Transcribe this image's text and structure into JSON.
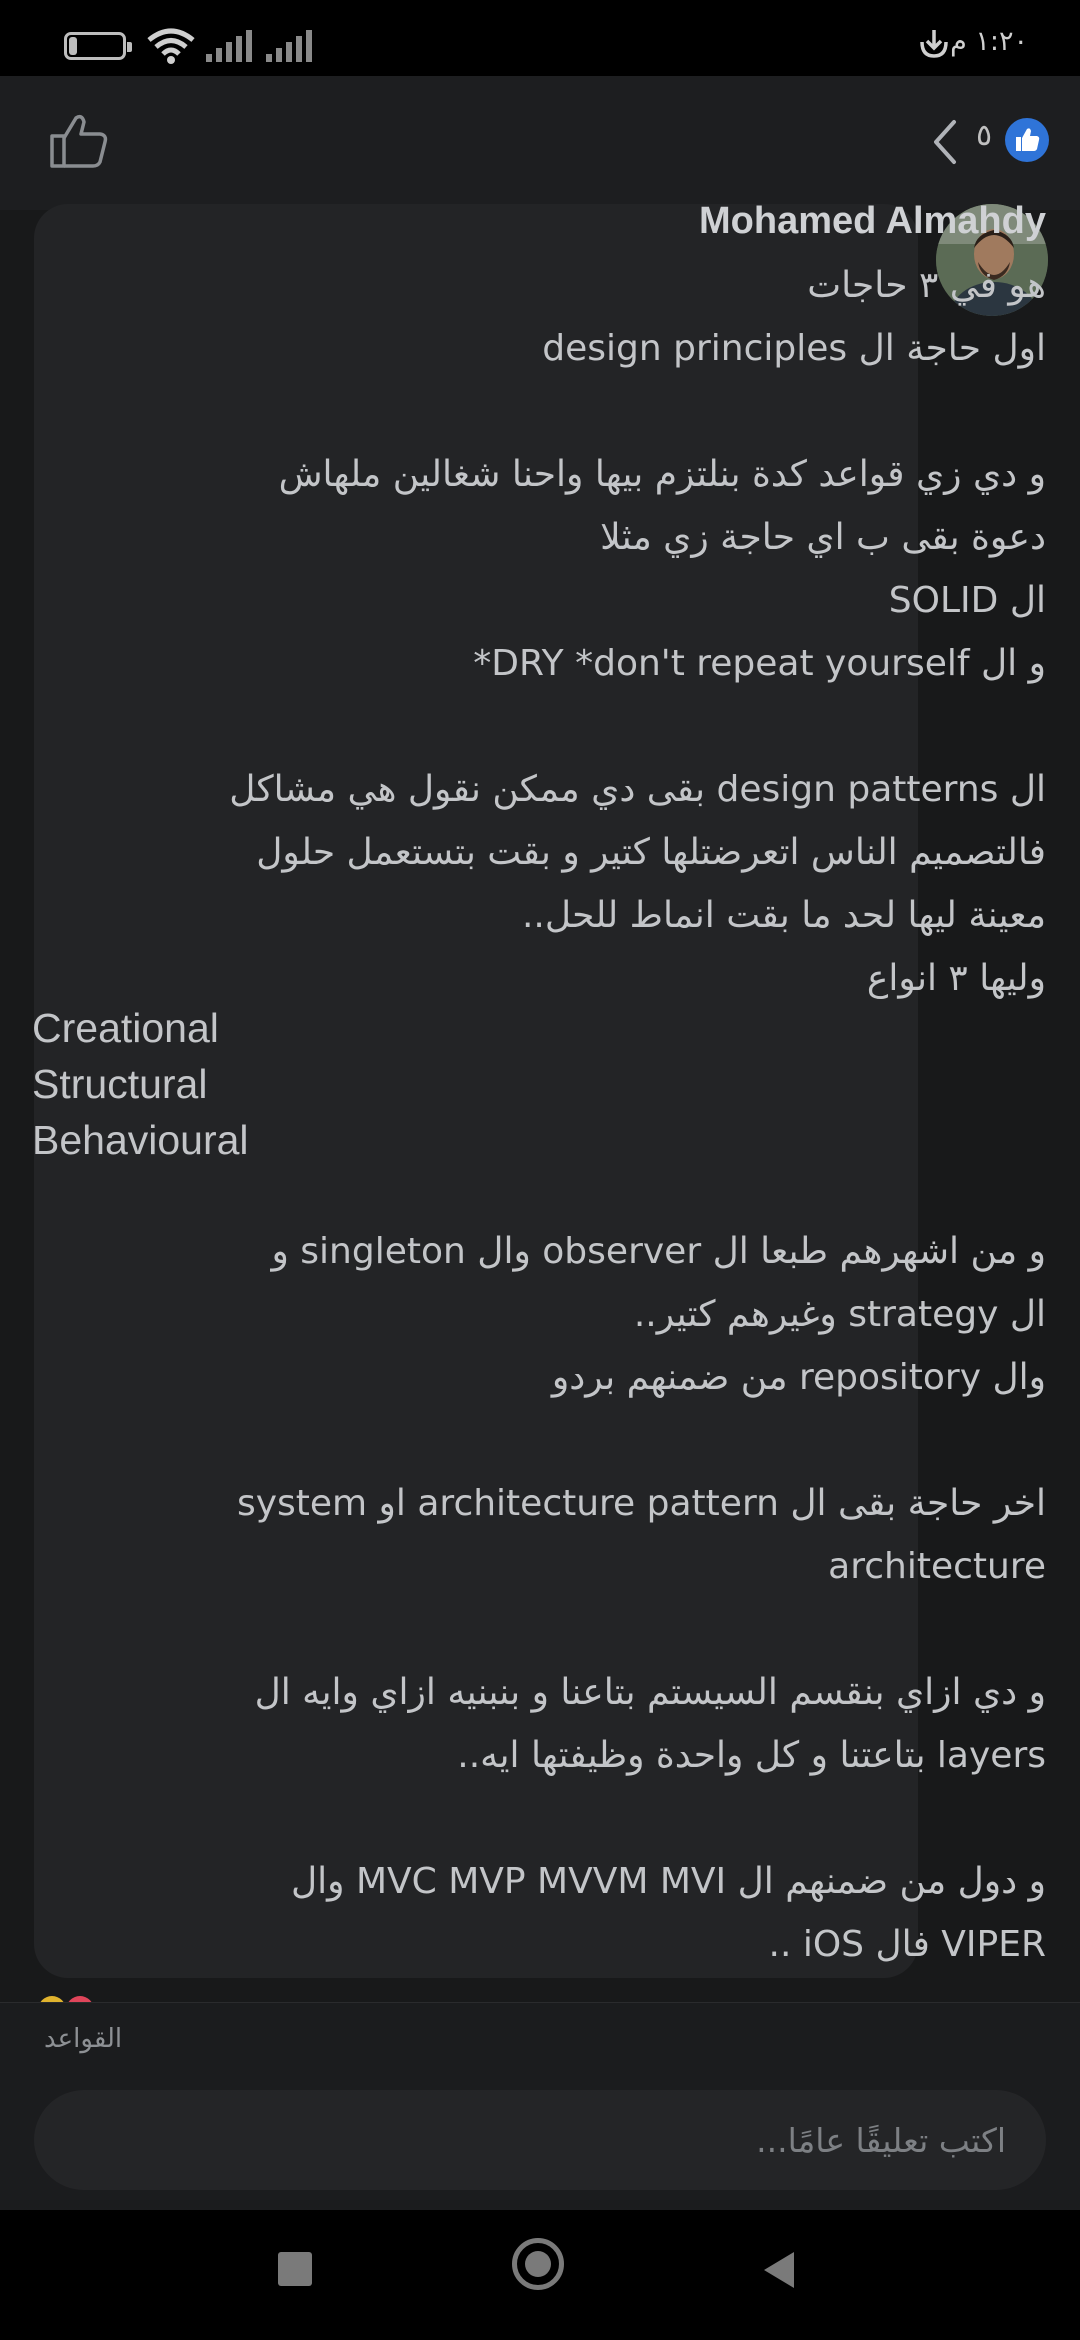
{
  "status_bar": {
    "battery_level": "15",
    "time": "١:٢٠ م",
    "battery_fraction": 0.15
  },
  "header": {
    "reaction_count": "٥"
  },
  "comment": {
    "author": "Mohamed Almahdy",
    "text_part1": "هو في ٣ حاجات\nاول حاجة ال design principles\n\nو دي زي قواعد كدة بنلتزم بيها واحنا شغالين ملهاش دعوة بقى ب اي حاجة زي مثلا\nال SOLID\nو ال DRY *don't repeat yourself*\n\nال design patterns بقى دي ممكن نقول هي مشاكل فالتصميم الناس اتعرضتلها كتير و بقت بتستعمل حلول معينة ليها لحد ما بقت انماط للحل..\nوليها ٣ انواع",
    "types": [
      "Creational",
      "Structural",
      "Behavioural"
    ],
    "text_part2": "و من اشهرهم طبعا ال observer وال singleton و ال strategy وغيرهم كتير..\nوال repository من ضمنهم بردو\n\nاخر حاجة بقى ال architecture pattern او system architecture\n\nو دي ازاي بنقسم السيستم بتاعنا و بنبنيه ازاي وايه ال layers بتاعتنا و كل واحدة وظيفتها ايه..\n\nو دول من ضمنهم ال MVC MVP MVVM MVI وال VIPER فال iOS .."
  },
  "footer": {
    "rules_label": "القواعد",
    "comment_placeholder": "اكتب تعليقًا عامًا..."
  },
  "colors": {
    "background": "#18191a",
    "bubble": "#232426",
    "accent_like": "#2f74d8"
  }
}
